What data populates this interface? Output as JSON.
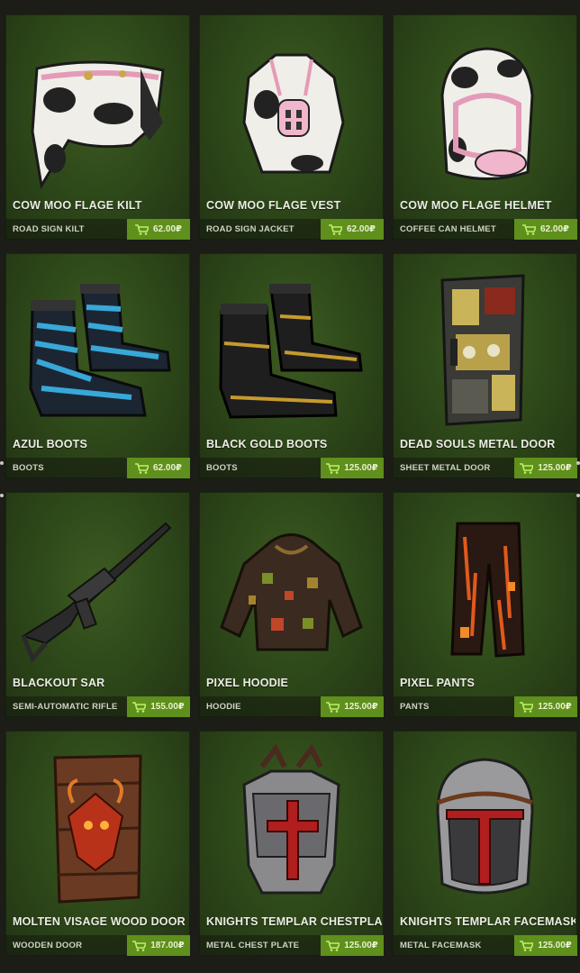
{
  "store": {
    "items": [
      {
        "name": "COW MOO FLAGE KILT",
        "type": "ROAD SIGN KILT",
        "price": "62.00₽",
        "icon": "kilt-icon"
      },
      {
        "name": "COW MOO FLAGE VEST",
        "type": "ROAD SIGN JACKET",
        "price": "62.00₽",
        "icon": "vest-icon"
      },
      {
        "name": "COW MOO FLAGE HELMET",
        "type": "COFFEE CAN HELMET",
        "price": "62.00₽",
        "icon": "helmet-icon"
      },
      {
        "name": "AZUL BOOTS",
        "type": "BOOTS",
        "price": "62.00₽",
        "icon": "boots-icon"
      },
      {
        "name": "BLACK GOLD BOOTS",
        "type": "BOOTS",
        "price": "125.00₽",
        "icon": "boots-icon"
      },
      {
        "name": "DEAD SOULS METAL DOOR",
        "type": "SHEET METAL DOOR",
        "price": "125.00₽",
        "icon": "door-icon"
      },
      {
        "name": "BLACKOUT SAR",
        "type": "SEMI-AUTOMATIC RIFLE",
        "price": "155.00₽",
        "icon": "rifle-icon"
      },
      {
        "name": "PIXEL HOODIE",
        "type": "HOODIE",
        "price": "125.00₽",
        "icon": "hoodie-icon"
      },
      {
        "name": "PIXEL PANTS",
        "type": "PANTS",
        "price": "125.00₽",
        "icon": "pants-icon"
      },
      {
        "name": "MOLTEN VISAGE WOOD DOOR",
        "type": "WOODEN DOOR",
        "price": "187.00₽",
        "icon": "wood-door-icon"
      },
      {
        "name": "KNIGHTS TEMPLAR CHESTPLATE",
        "type": "METAL CHEST PLATE",
        "price": "125.00₽",
        "icon": "chestplate-icon"
      },
      {
        "name": "KNIGHTS TEMPLAR FACEMASK",
        "type": "METAL FACEMASK",
        "price": "125.00₽",
        "icon": "facemask-icon"
      }
    ]
  },
  "colors": {
    "card_background": "#2f4a1a",
    "price_button": "#5f8f1c",
    "page_background": "#1b1d16"
  }
}
